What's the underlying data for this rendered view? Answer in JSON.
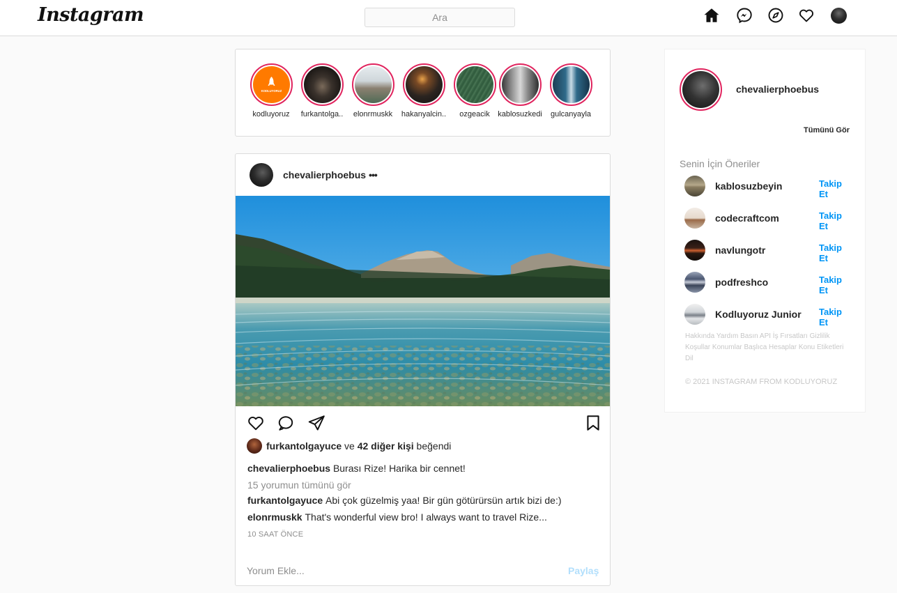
{
  "header": {
    "logo": "Instagram",
    "search_placeholder": "Ara",
    "icons": [
      "home-icon",
      "messenger-icon",
      "explore-icon",
      "heart-icon",
      "profile-avatar"
    ]
  },
  "stories": [
    {
      "name": "kodluyoruz",
      "logo_text": "KODLUYORUZ"
    },
    {
      "name": "furkantolga.."
    },
    {
      "name": "elonrmuskk"
    },
    {
      "name": "hakanyalcin.."
    },
    {
      "name": "ozgeacik"
    },
    {
      "name": "kablosuzkedi"
    },
    {
      "name": "gulcanyayla"
    }
  ],
  "post": {
    "username": "chevalierphoebus",
    "more": "•••",
    "liked_by_user": "furkantolgayuce",
    "liked_connector": "ve",
    "liked_others": "42 diğer kişi",
    "liked_suffix": "beğendi",
    "caption_user": "chevalierphoebus",
    "caption_text": "Burası Rize! Harika bir cennet!",
    "view_comments": "15 yorumun tümünü gör",
    "comments": [
      {
        "user": "furkantolgayuce",
        "text": "Abi çok güzelmiş yaa! Bir gün götürürsün artık bizi de:)"
      },
      {
        "user": "elonrmuskk",
        "text": "That's wonderful view bro! I always want to travel Rize..."
      }
    ],
    "time": "10 SAAT ÖNCE",
    "comment_placeholder": "Yorum Ekle...",
    "share_label": "Paylaş"
  },
  "sidebar": {
    "username": "chevalierphoebus",
    "see_all": "Tümünü Gör",
    "suggestions_title": "Senin İçin Öneriler",
    "suggestions": [
      {
        "name": "kablosuzbeyin",
        "follow": "Takip Et"
      },
      {
        "name": "codecraftcom",
        "follow": "Takip Et"
      },
      {
        "name": "navlungotr",
        "follow": "Takip Et"
      },
      {
        "name": "podfreshco",
        "follow": "Takip Et"
      },
      {
        "name": "Kodluyoruz Junior",
        "follow": "Takip Et"
      }
    ],
    "footer_links": "Hakkında Yardım Basın API İş Fırsatları Gizlilik Koşullar Konumlar Başlıca Hesaplar Konu Etiketleri Dil",
    "copyright": "© 2021 INSTAGRAM FROM KODLUYORUZ"
  },
  "colors": {
    "accent_blue": "#0095f6",
    "story_ring": "#e0245e",
    "share_disabled": "#b2dffc"
  }
}
